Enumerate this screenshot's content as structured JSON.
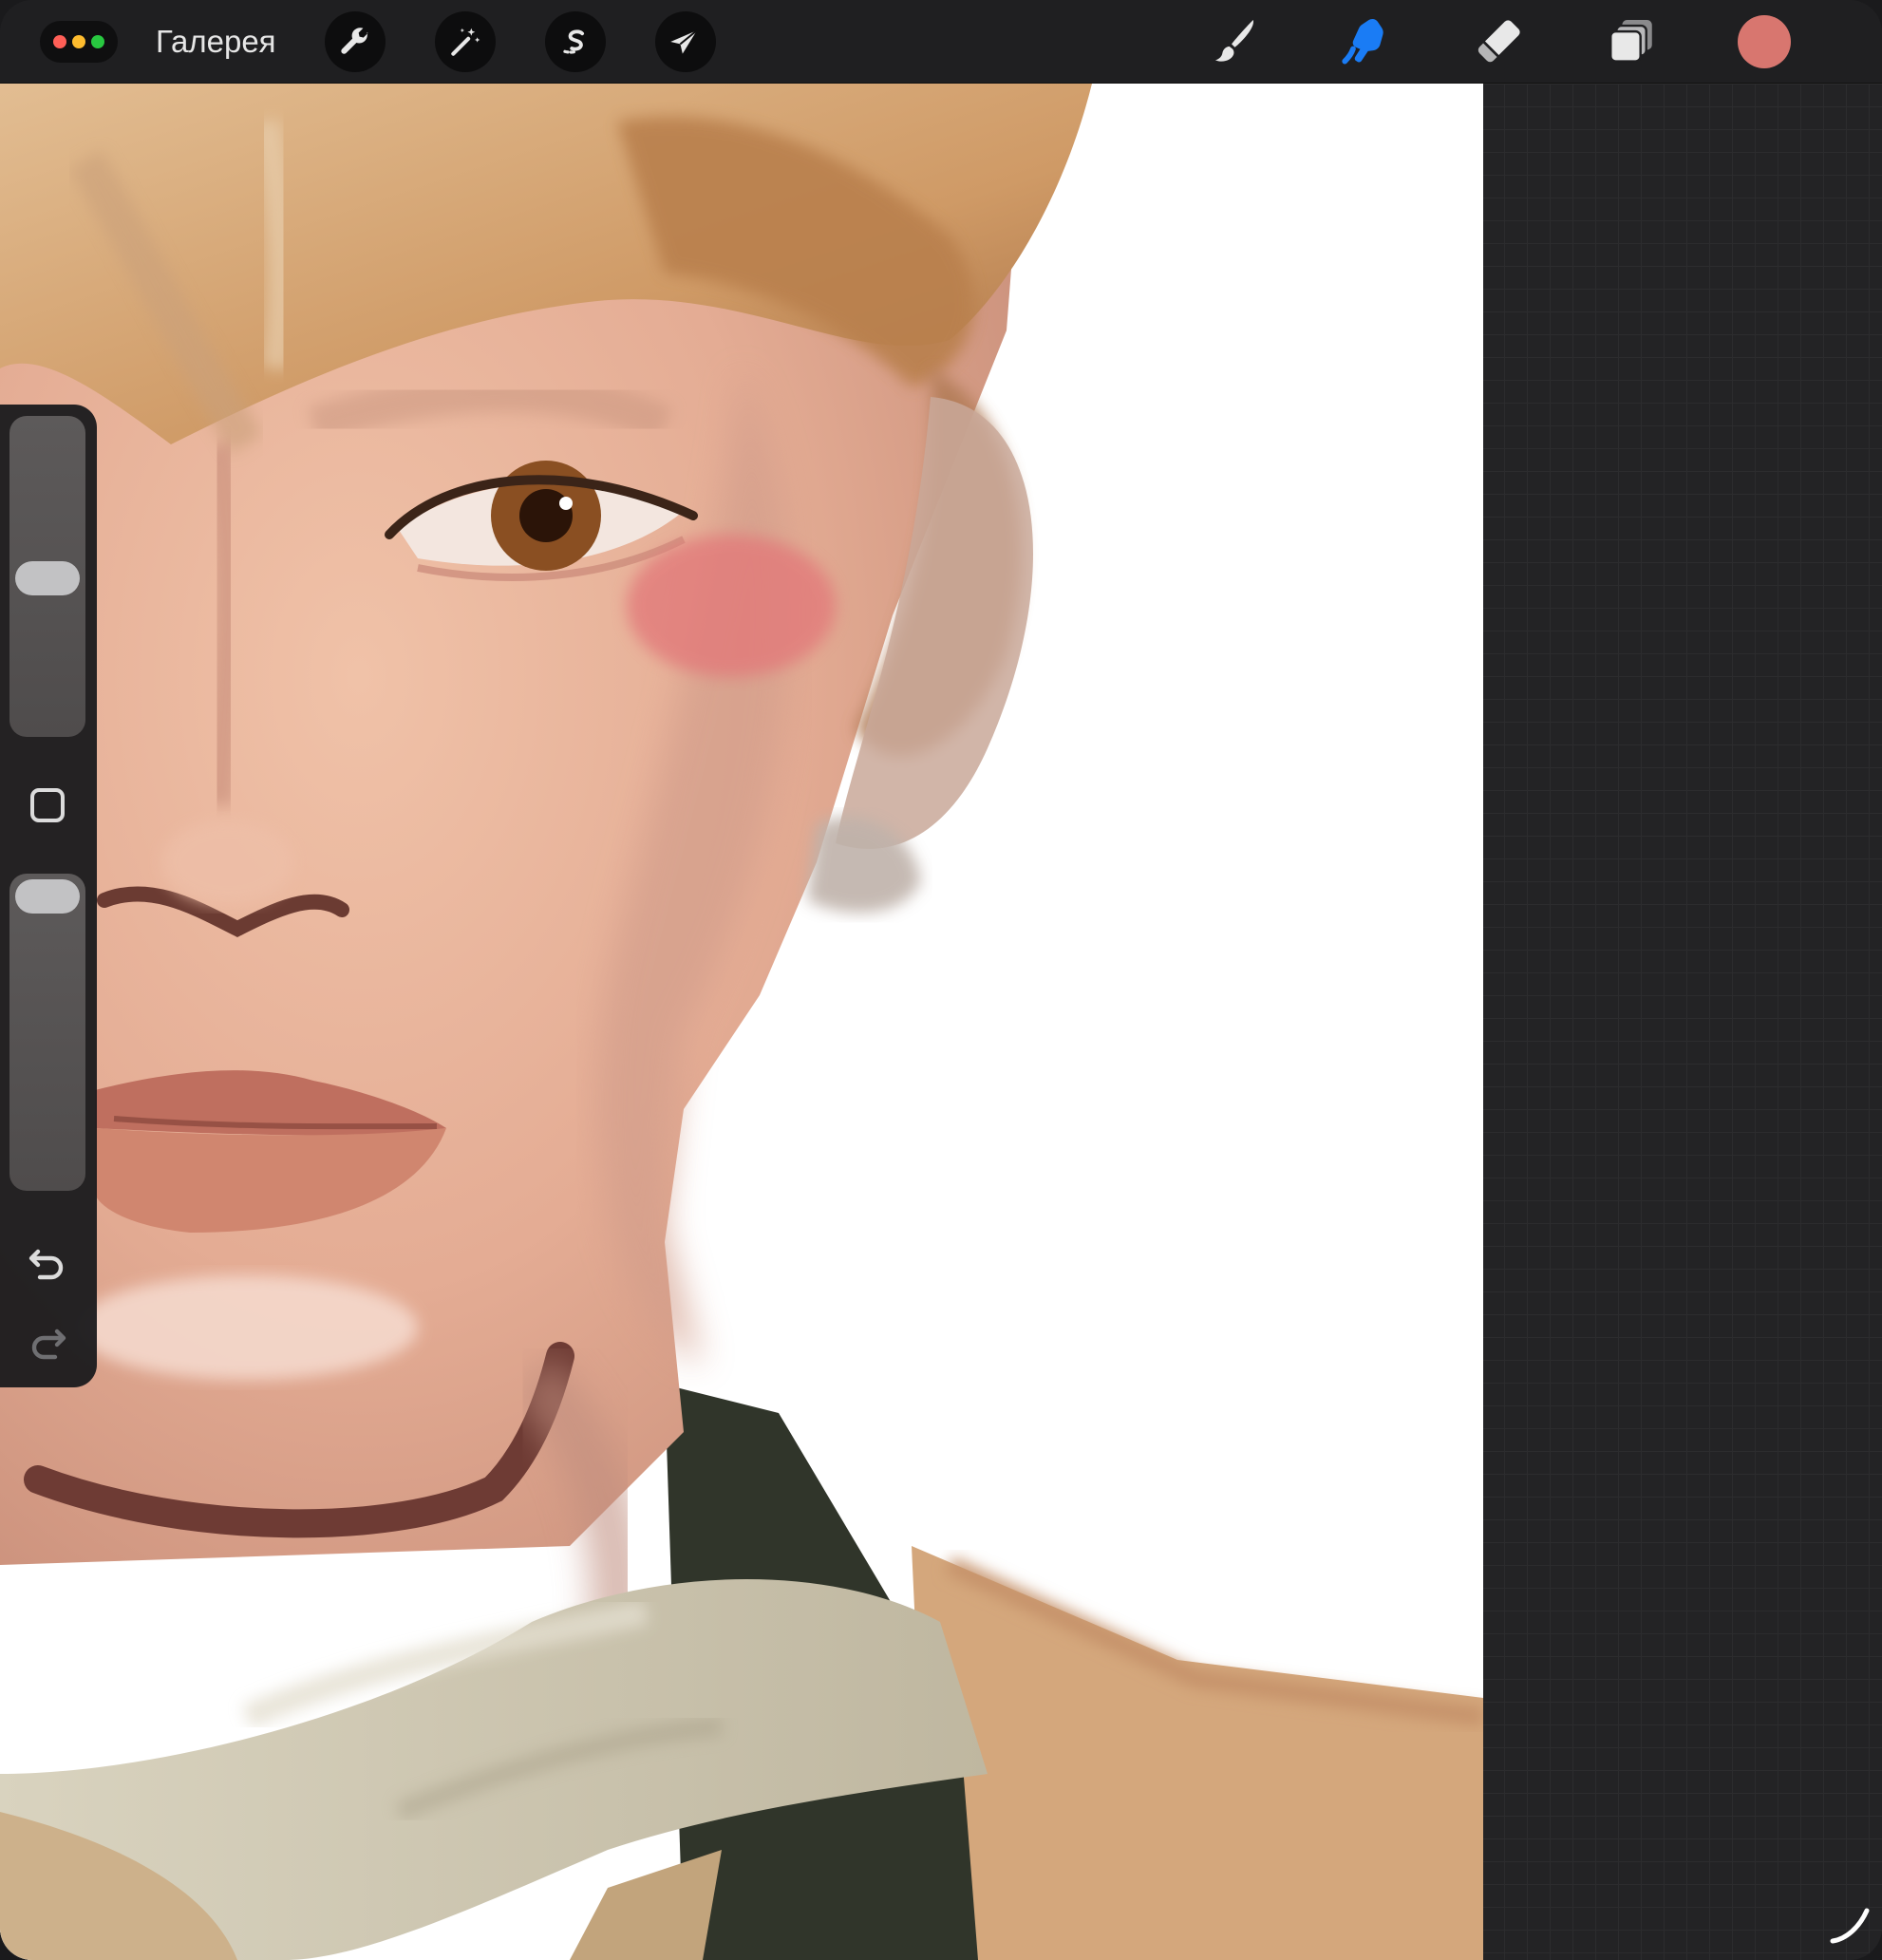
{
  "toolbar": {
    "gallery_label": "Галерея",
    "left_tools": [
      {
        "name": "actions",
        "icon": "wrench-icon"
      },
      {
        "name": "adjustments",
        "icon": "magic-wand-icon"
      },
      {
        "name": "selection",
        "icon": "selection-s-icon"
      },
      {
        "name": "transform",
        "icon": "arrow-cursor-icon"
      }
    ],
    "right_tools": [
      {
        "name": "brush",
        "icon": "brush-icon",
        "active": false
      },
      {
        "name": "smudge",
        "icon": "smudge-finger-icon",
        "active": true
      },
      {
        "name": "eraser",
        "icon": "eraser-icon",
        "active": false
      },
      {
        "name": "layers",
        "icon": "layers-icon",
        "active": false
      }
    ],
    "current_color": "#d8766f"
  },
  "colors": {
    "accent_active": "#1a7cf5",
    "icon_default": "#e8e8e8",
    "toolbar_bg": "#1f1f21"
  },
  "sidebar": {
    "brush_size_level": 0.52,
    "opacity_level": 0.05,
    "modify_button_icon": "square-modify-icon",
    "undo_icon": "undo-icon",
    "redo_icon": "redo-icon"
  }
}
